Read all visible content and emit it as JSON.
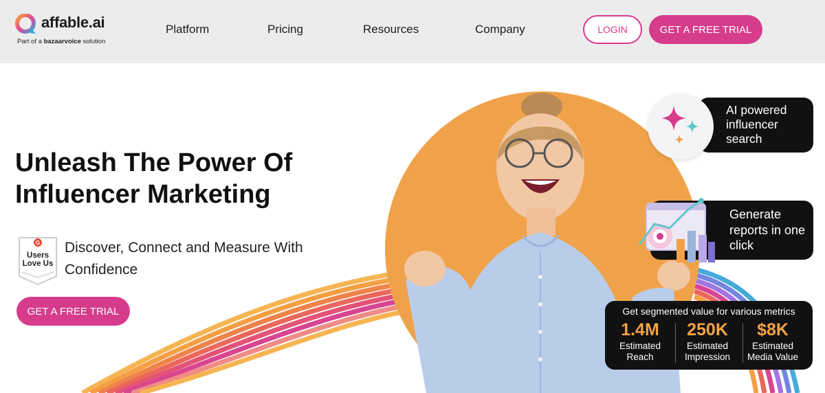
{
  "brand": {
    "logo_text": "affable.ai",
    "sub_prefix": "Part of a ",
    "sub_brand": "bazaarvoice",
    "sub_suffix": " solution"
  },
  "nav": {
    "items": [
      {
        "label": "Platform"
      },
      {
        "label": "Pricing"
      },
      {
        "label": "Resources"
      },
      {
        "label": "Company"
      }
    ],
    "login_label": "LOGIN",
    "trial_label": "GET A FREE TRIAL"
  },
  "hero": {
    "headline_line1": "Unleash The Power Of",
    "headline_line2": "Influencer Marketing",
    "tagline": "Discover, Connect and Measure With Confidence",
    "badge_line1": "Users",
    "badge_line2": "Love Us",
    "trial_label": "GET A FREE TRIAL"
  },
  "features": {
    "ai_search": "AI powered influencer search",
    "reports": "Generate reports in one click",
    "metrics_title": "Get segmented value for various metrics",
    "metrics": [
      {
        "value": "1.4M",
        "label_line1": "Estimated",
        "label_line2": "Reach"
      },
      {
        "value": "250K",
        "label_line1": "Estimated",
        "label_line2": "Impression"
      },
      {
        "value": "$8K",
        "label_line1": "Estimated",
        "label_line2": "Media Value"
      }
    ]
  },
  "colors": {
    "accent": "#d63c8b",
    "orange": "#f0a24a",
    "metric_value": "#f3a247",
    "header_bg": "#ececec",
    "card_bg": "#111111"
  },
  "icons": {
    "logo": "affable-logo-icon",
    "g2_badge": "g2-badge-icon",
    "sparkles": "sparkles-icon",
    "report": "report-illustration-icon"
  }
}
